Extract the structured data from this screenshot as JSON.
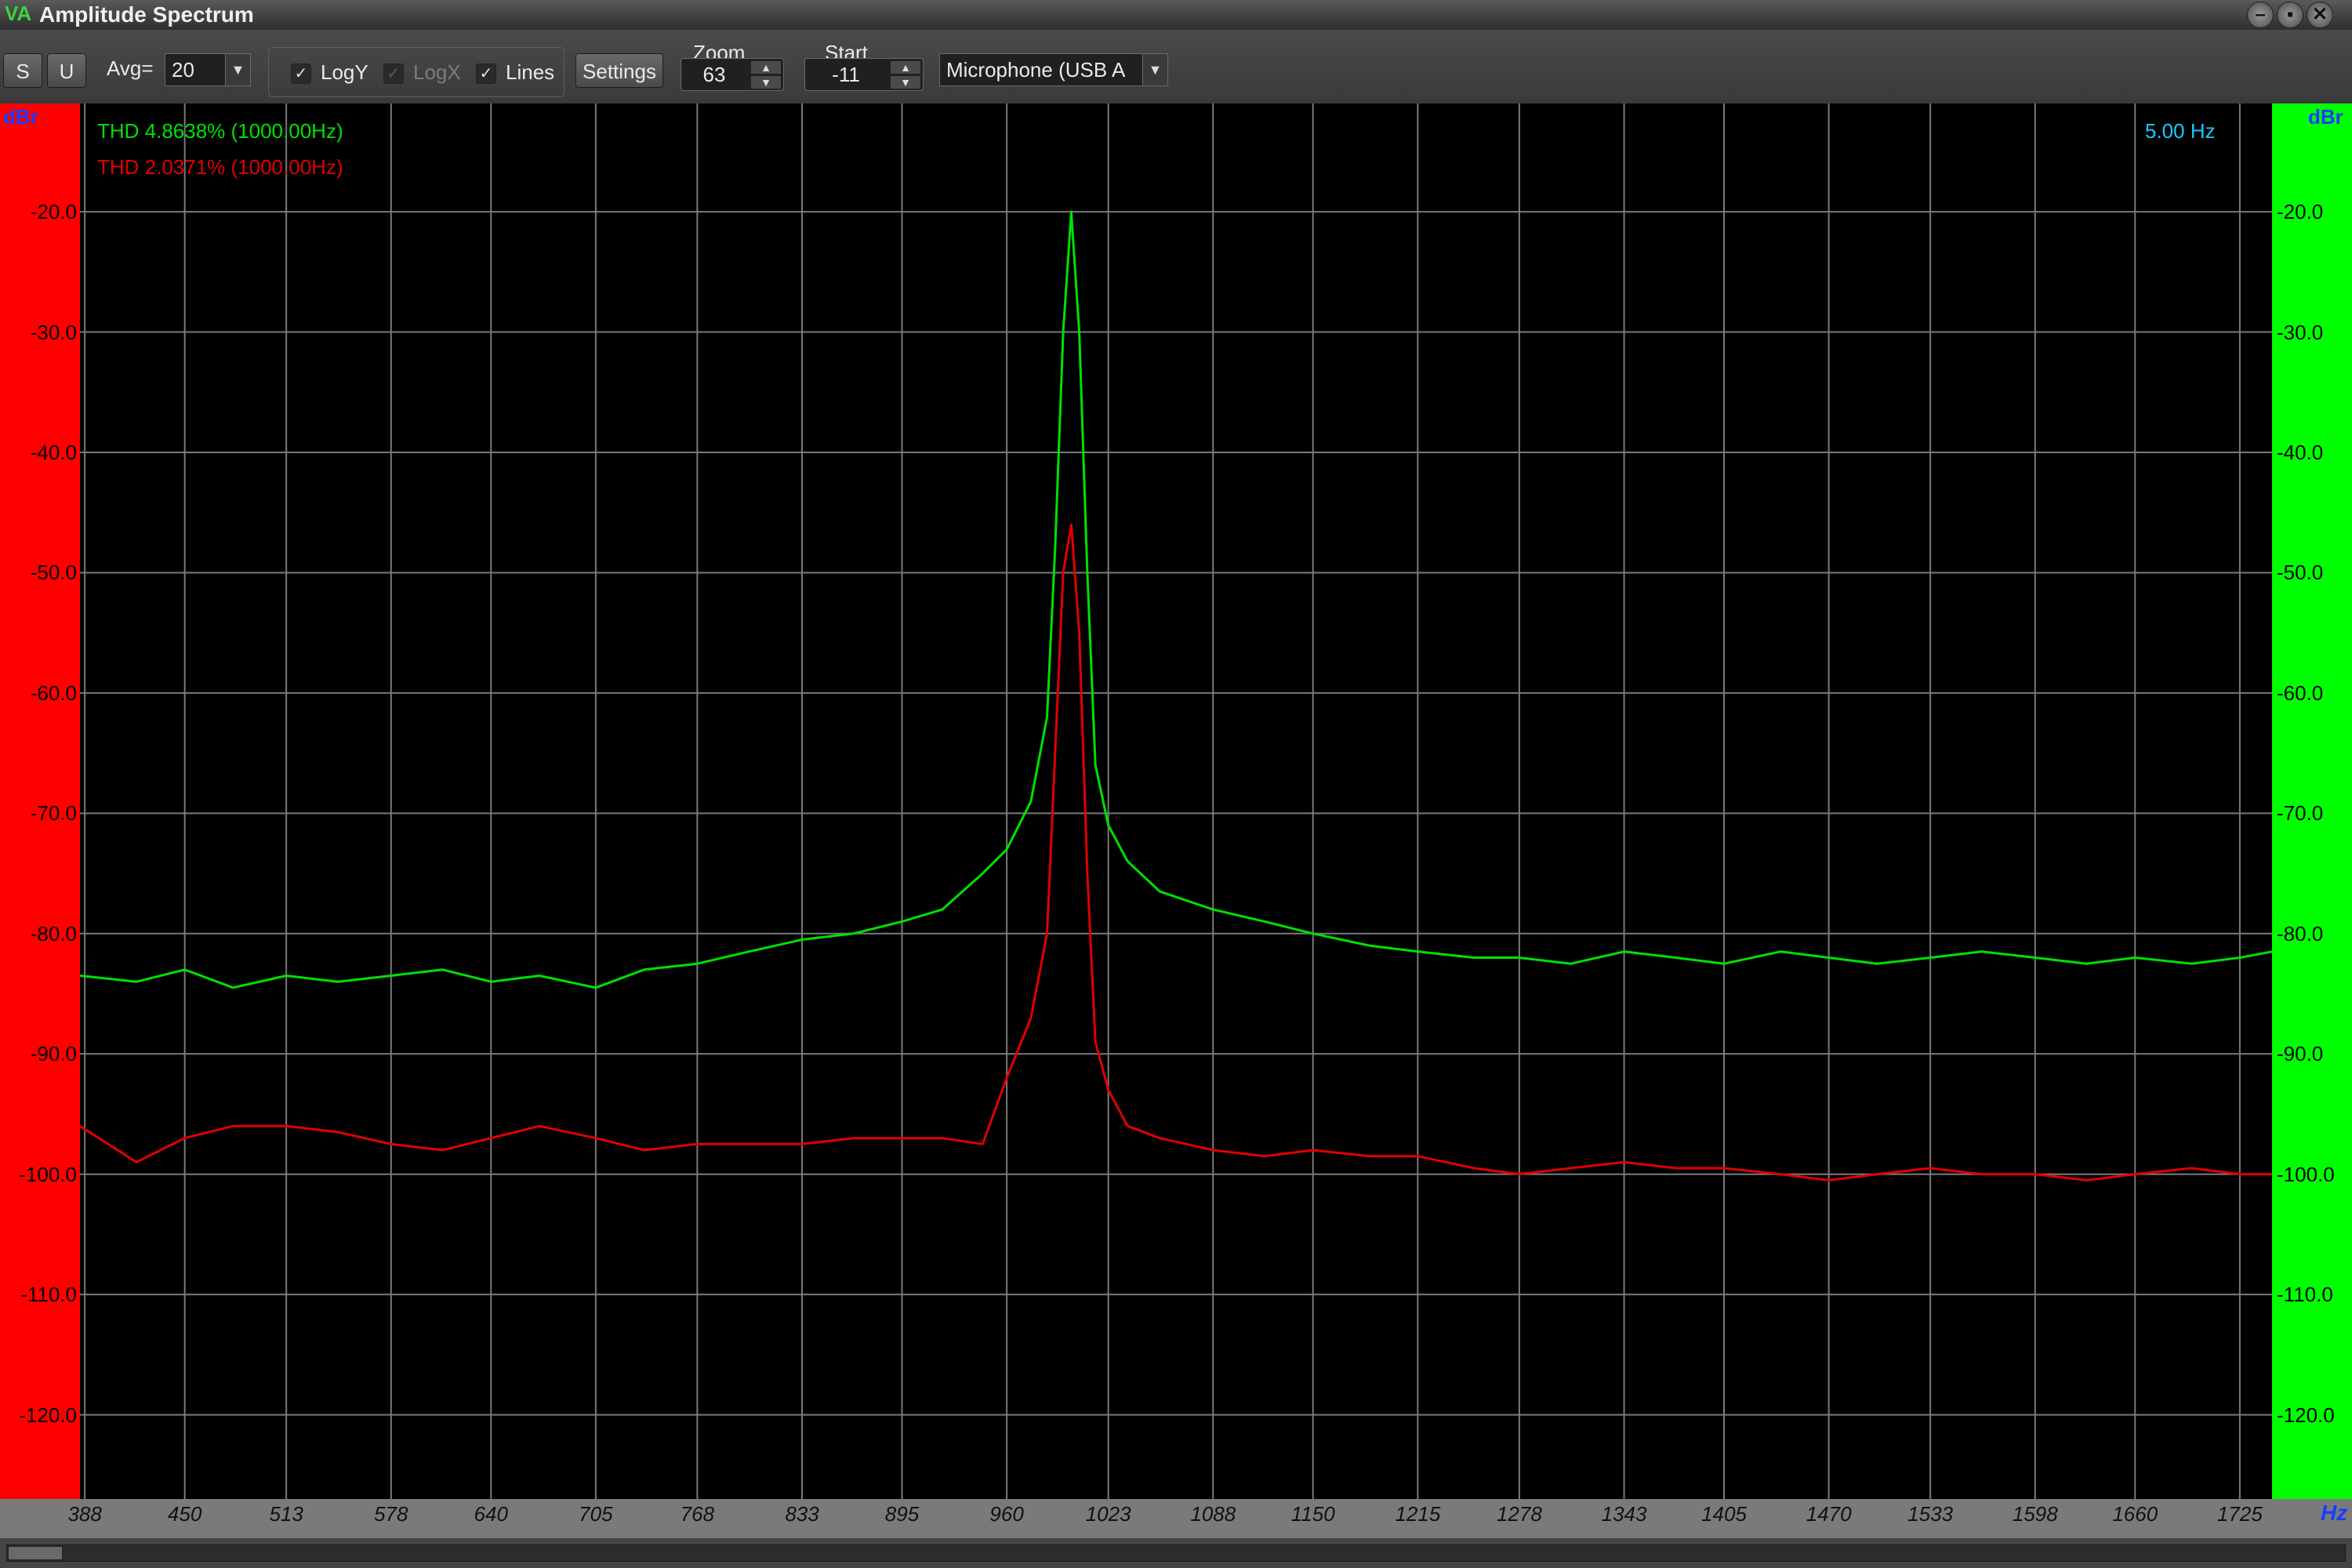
{
  "window": {
    "title": "Amplitude Spectrum",
    "logo": "VA",
    "controls": [
      "minimize-icon",
      "maximize-icon",
      "close-icon"
    ]
  },
  "toolbar": {
    "s_button": "S",
    "u_button": "U",
    "avg_label": "Avg=",
    "avg_value": "20",
    "logy_label": "LogY",
    "logy_checked": true,
    "logx_label": "LogX",
    "logx_checked": true,
    "logx_enabled": false,
    "lines_label": "Lines",
    "lines_checked": true,
    "settings_label": "Settings",
    "zoom_label": "Zoom",
    "zoom_value": "63",
    "start_label": "Start",
    "start_value": "-11",
    "device_value": "Microphone (USB A"
  },
  "readouts": {
    "thd_green": "THD 4.8638% (1000.00Hz)",
    "thd_red": "THD 2.0371% (1000.00Hz)",
    "resolution": "5.00 Hz"
  },
  "colors": {
    "series_green": "#00e000",
    "series_red": "#e00000",
    "left_bar": "#ff0000",
    "right_bar": "#00ff00",
    "grid": "#7a7a7a",
    "axis_unit": "#1a3cff",
    "resolution_text": "#19c8ff"
  },
  "chart_data": {
    "type": "line",
    "title": "Amplitude Spectrum",
    "xlabel": "Hz",
    "ylabel": "dBr",
    "xlim": [
      385,
      1745
    ],
    "ylim": [
      -127,
      -11
    ],
    "grid": true,
    "x_ticks": [
      388,
      450,
      513,
      578,
      640,
      705,
      768,
      833,
      895,
      960,
      1023,
      1088,
      1150,
      1215,
      1278,
      1343,
      1405,
      1470,
      1533,
      1598,
      1660,
      1725
    ],
    "x_tick_labels": [
      "388",
      "450",
      "513",
      "578",
      "640",
      "705",
      "768",
      "833",
      "895",
      "960",
      "1023",
      "1088",
      "1150",
      "1215",
      "1278",
      "1343",
      "1405",
      "1470",
      "1533",
      "1598",
      "1660",
      "1725"
    ],
    "y_ticks": [
      -20,
      -30,
      -40,
      -50,
      -60,
      -70,
      -80,
      -90,
      -100,
      -110,
      -120
    ],
    "y_tick_labels": [
      "-20.0",
      "-30.0",
      "-40.0",
      "-50.0",
      "-60.0",
      "-70.0",
      "-80.0",
      "-90.0",
      "-100.0",
      "-110.0",
      "-120.0"
    ],
    "series": [
      {
        "color": "#00e000",
        "x": [
          385,
          420,
          450,
          480,
          513,
          545,
          578,
          610,
          640,
          670,
          705,
          735,
          768,
          800,
          833,
          865,
          895,
          920,
          945,
          960,
          975,
          985,
          990,
          995,
          1000,
          1005,
          1010,
          1015,
          1023,
          1035,
          1055,
          1088,
          1120,
          1150,
          1185,
          1215,
          1250,
          1278,
          1310,
          1343,
          1375,
          1405,
          1440,
          1470,
          1500,
          1533,
          1565,
          1598,
          1630,
          1660,
          1695,
          1725,
          1745
        ],
        "y": [
          -83.5,
          -84,
          -83,
          -84.5,
          -83.5,
          -84,
          -83.5,
          -83,
          -84,
          -83.5,
          -84.5,
          -83,
          -82.5,
          -81.5,
          -80.5,
          -80,
          -79,
          -78,
          -75,
          -73,
          -69,
          -62,
          -48,
          -30,
          -20,
          -30,
          -50,
          -66,
          -71,
          -74,
          -76.5,
          -78,
          -79,
          -80,
          -81,
          -81.5,
          -82,
          -82,
          -82.5,
          -81.5,
          -82,
          -82.5,
          -81.5,
          -82,
          -82.5,
          -82,
          -81.5,
          -82,
          -82.5,
          -82,
          -82.5,
          -82,
          -81.5
        ]
      },
      {
        "color": "#e00000",
        "x": [
          385,
          420,
          450,
          480,
          513,
          545,
          578,
          610,
          640,
          670,
          705,
          735,
          768,
          800,
          833,
          865,
          895,
          920,
          945,
          960,
          975,
          985,
          990,
          995,
          1000,
          1005,
          1010,
          1015,
          1023,
          1035,
          1055,
          1088,
          1120,
          1150,
          1185,
          1215,
          1250,
          1278,
          1310,
          1343,
          1375,
          1405,
          1440,
          1470,
          1500,
          1533,
          1565,
          1598,
          1630,
          1660,
          1695,
          1725,
          1745
        ],
        "y": [
          -96,
          -99,
          -97,
          -96,
          -96,
          -96.5,
          -97.5,
          -98,
          -97,
          -96,
          -97,
          -98,
          -97.5,
          -97.5,
          -97.5,
          -97,
          -97,
          -97,
          -97.5,
          -92,
          -87,
          -80,
          -65,
          -50,
          -46,
          -55,
          -75,
          -89,
          -93,
          -96,
          -97,
          -98,
          -98.5,
          -98,
          -98.5,
          -98.5,
          -99.5,
          -100,
          -99.5,
          -99,
          -99.5,
          -99.5,
          -100,
          -100.5,
          -100,
          -99.5,
          -100,
          -100,
          -100.5,
          -100,
          -99.5,
          -100,
          -100
        ]
      }
    ]
  }
}
